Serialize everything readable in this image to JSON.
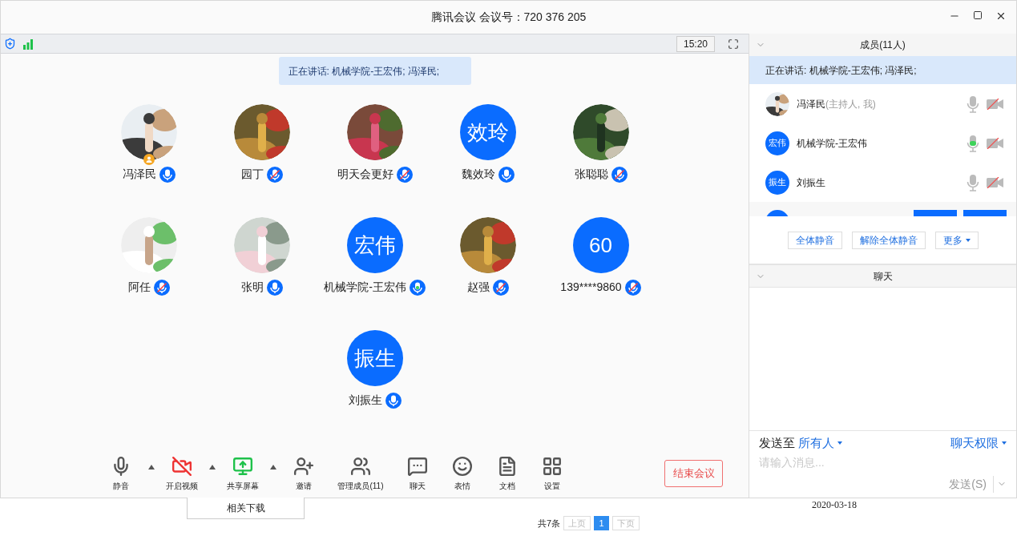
{
  "window": {
    "title": "腾讯会议 会议号：720 376 205"
  },
  "top_bar": {
    "time": "15:20"
  },
  "speaking_banner": "正在讲话: 机械学院-王宏伟; 冯泽民;",
  "participants": [
    {
      "name": "冯泽民",
      "muted": false,
      "speaking": false,
      "host": true
    },
    {
      "name": "园丁",
      "muted": true,
      "speaking": false,
      "host": false
    },
    {
      "name": "明天会更好",
      "muted": true,
      "speaking": false,
      "host": false
    },
    {
      "name": "魏效玲",
      "avatar": {
        "kind": "initials",
        "text": "效玲"
      },
      "muted": false,
      "speaking": false,
      "host": false
    },
    {
      "name": "张聪聪",
      "muted": true,
      "speaking": false,
      "host": false
    },
    {
      "name": "阿任",
      "muted": true,
      "speaking": false,
      "host": false
    },
    {
      "name": "张明",
      "muted": false,
      "speaking": false,
      "host": false
    },
    {
      "name": "机械学院-王宏伟",
      "avatar": {
        "kind": "initials",
        "text": "宏伟"
      },
      "muted": false,
      "speaking": true,
      "host": false
    },
    {
      "name": "赵强",
      "muted": true,
      "speaking": false,
      "host": false
    },
    {
      "name": "139****9860",
      "avatar": {
        "kind": "initials",
        "text": "60"
      },
      "muted": true,
      "speaking": false,
      "host": false
    },
    {
      "name": "刘振生",
      "avatar": {
        "kind": "initials",
        "text": "振生"
      },
      "muted": false,
      "speaking": false,
      "host": false
    }
  ],
  "toolbar": [
    {
      "label": "静音",
      "kind": "mic",
      "caret": true
    },
    {
      "label": "开启视频",
      "kind": "video",
      "caret": true
    },
    {
      "label": "共享屏幕",
      "kind": "share",
      "caret": true
    },
    {
      "label": "邀请",
      "kind": "invite",
      "caret": false
    },
    {
      "label": "管理成员(11)",
      "kind": "members",
      "caret": false
    },
    {
      "label": "聊天",
      "kind": "chat",
      "caret": false
    },
    {
      "label": "表情",
      "kind": "emoji",
      "caret": false
    },
    {
      "label": "文档",
      "kind": "doc",
      "caret": false
    },
    {
      "label": "设置",
      "kind": "settings",
      "caret": false
    }
  ],
  "end_button": "结束会议",
  "members_panel": {
    "title": "成员(11人)",
    "speaking": "正在讲话: 机械学院-王宏伟; 冯泽民;",
    "rows": [
      {
        "name": "冯泽民",
        "role": "(主持人, 我)",
        "speaking": false
      },
      {
        "name": "机械学院-王宏伟",
        "avatar": {
          "kind": "initials",
          "text": "宏伟"
        },
        "speaking": true
      },
      {
        "name": "刘振生",
        "avatar": {
          "kind": "initials",
          "text": "振生"
        },
        "speaking": false
      }
    ],
    "buttons": [
      {
        "label": "全体静音",
        "caret": false
      },
      {
        "label": "解除全体静音",
        "caret": false
      },
      {
        "label": "更多",
        "caret": true
      }
    ]
  },
  "chat": {
    "title": "聊天",
    "send_to": "发送至",
    "recipient": "所有人",
    "permission": "聊天权限",
    "placeholder": "请输入消息...",
    "send": "发送(S)"
  },
  "background_page": {
    "download": "相关下载",
    "date": "2020-03-18",
    "total": "共7条",
    "prev": "上页",
    "pages": [
      {
        "label": "1",
        "selected": true
      }
    ],
    "next": "下页"
  }
}
